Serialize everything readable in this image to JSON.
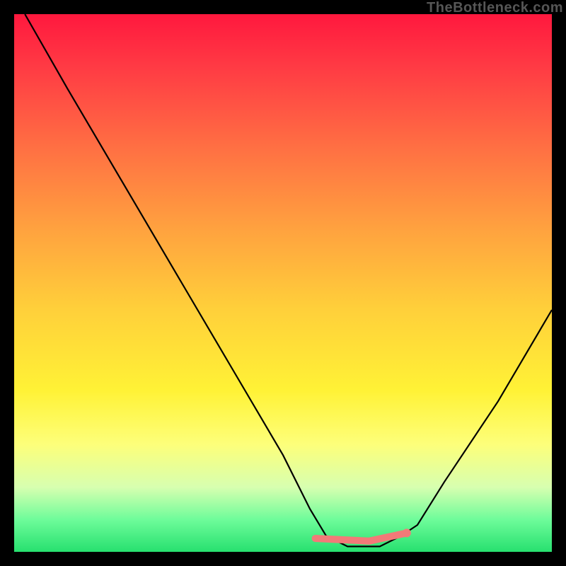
{
  "attribution": "TheBottleneck.com",
  "chart_data": {
    "type": "line",
    "title": "",
    "xlabel": "",
    "ylabel": "",
    "xlim": [
      0,
      1
    ],
    "ylim": [
      0,
      1
    ],
    "series": [
      {
        "name": "bottleneck-curve",
        "x": [
          0.02,
          0.1,
          0.2,
          0.3,
          0.4,
          0.5,
          0.55,
          0.58,
          0.62,
          0.68,
          0.72,
          0.75,
          0.8,
          0.9,
          1.0
        ],
        "values": [
          1.0,
          0.86,
          0.69,
          0.52,
          0.35,
          0.18,
          0.08,
          0.03,
          0.01,
          0.01,
          0.03,
          0.05,
          0.13,
          0.28,
          0.45
        ]
      },
      {
        "name": "marker-band",
        "x": [
          0.56,
          0.66,
          0.73
        ],
        "values": [
          0.025,
          0.02,
          0.035
        ]
      }
    ],
    "colors": {
      "curve": "#000000",
      "marker": "#f27a78",
      "gradient_top": "#ff183e",
      "gradient_mid": "#fff236",
      "gradient_bot": "#27e06f"
    }
  }
}
